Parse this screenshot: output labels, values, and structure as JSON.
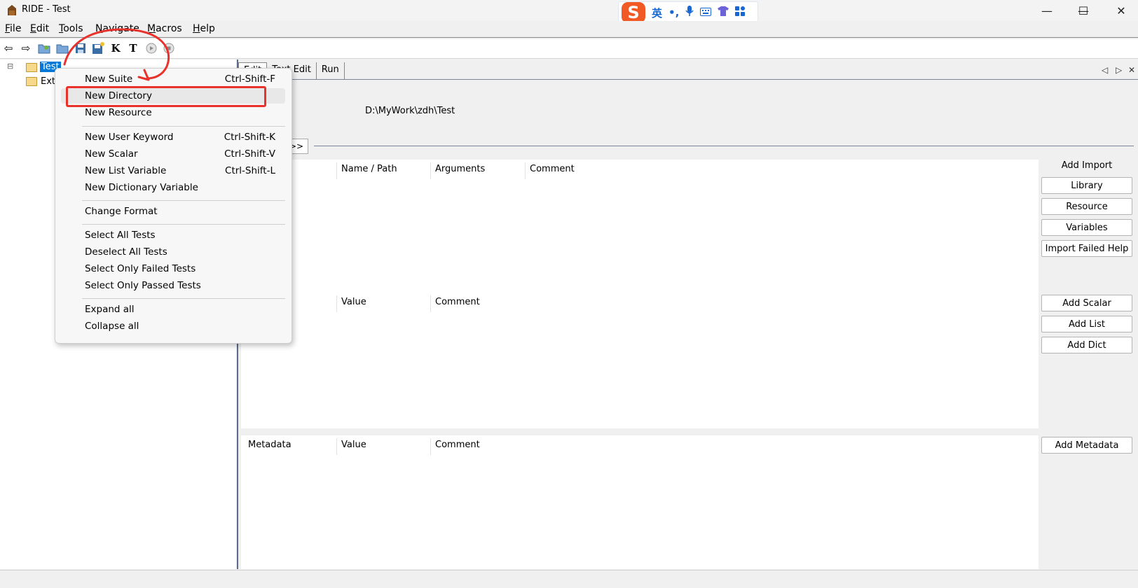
{
  "window": {
    "title": "RIDE - Test",
    "minimize": "—",
    "maximize": "☐",
    "close": "✕"
  },
  "ime": {
    "logo": "S",
    "lang": "英",
    "punct": "•,",
    "mic": "🎤",
    "keyboard": "⌨",
    "skin": "👕",
    "apps": "▦"
  },
  "menubar": [
    {
      "u": "F",
      "rest": "ile"
    },
    {
      "u": "E",
      "rest": "dit"
    },
    {
      "u": "T",
      "rest": "ools"
    },
    {
      "u": "N",
      "rest": "avigate"
    },
    {
      "u": "M",
      "rest": "acros"
    },
    {
      "u": "H",
      "rest": "elp"
    }
  ],
  "toolbar": {
    "back": "⇦",
    "forward": "⇨",
    "open_suite": "📂",
    "open_dir": "📁",
    "save": "💾",
    "save_all": "💾",
    "keyword": "K",
    "test": "T",
    "run": "▶",
    "stop": "■"
  },
  "tree": {
    "expander": "⊟",
    "root": "Test",
    "child": "Ext"
  },
  "tabs": {
    "edit": "Edit",
    "text_edit": "Text Edit",
    "run": "Run"
  },
  "tab_controls": {
    "left": "◁",
    "right": "▷",
    "close": "✕"
  },
  "settings": {
    "path": "D:\\MyWork\\zdh\\Test",
    "expand_label": ">>"
  },
  "imports": {
    "columns": [
      "Name / Path",
      "Arguments",
      "Comment"
    ],
    "title": "Add Import",
    "buttons": [
      "Library",
      "Resource",
      "Variables",
      "Import Failed Help"
    ]
  },
  "variables": {
    "columns": [
      "Value",
      "Comment"
    ],
    "buttons": [
      "Add Scalar",
      "Add List",
      "Add Dict"
    ]
  },
  "metadata": {
    "columns": [
      "Metadata",
      "Value",
      "Comment"
    ],
    "button": "Add Metadata"
  },
  "context_menu": {
    "items": [
      {
        "label": "New Suite",
        "shortcut": "Ctrl-Shift-F"
      },
      {
        "label": "New Directory",
        "shortcut": ""
      },
      {
        "label": "New Resource",
        "shortcut": ""
      },
      {
        "label": "New User Keyword",
        "shortcut": "Ctrl-Shift-K"
      },
      {
        "label": "New Scalar",
        "shortcut": "Ctrl-Shift-V"
      },
      {
        "label": "New List Variable",
        "shortcut": "Ctrl-Shift-L"
      },
      {
        "label": "New Dictionary Variable",
        "shortcut": ""
      },
      {
        "label": "Change Format",
        "shortcut": ""
      },
      {
        "label": "Select All Tests",
        "shortcut": ""
      },
      {
        "label": "Deselect All Tests",
        "shortcut": ""
      },
      {
        "label": "Select Only Failed Tests",
        "shortcut": ""
      },
      {
        "label": "Select Only Passed Tests",
        "shortcut": ""
      },
      {
        "label": "Expand all",
        "shortcut": ""
      },
      {
        "label": "Collapse all",
        "shortcut": ""
      }
    ],
    "highlighted": "New Directory"
  },
  "annotation": {
    "color": "#e8322b"
  }
}
